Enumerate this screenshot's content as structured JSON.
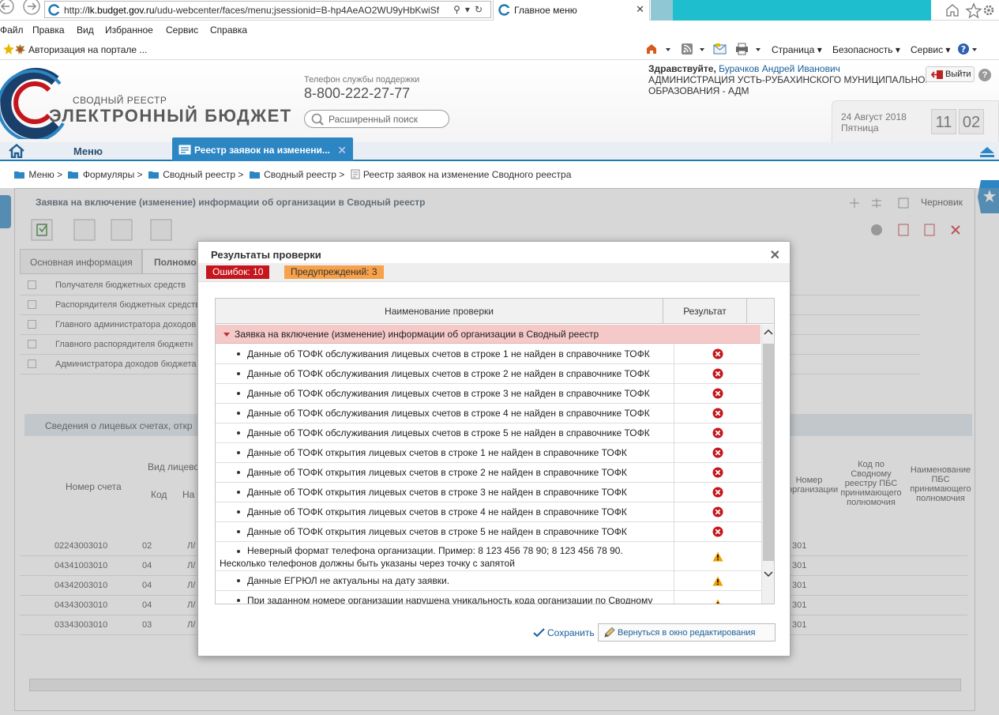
{
  "browser": {
    "url_prefix": "http://",
    "url_domain": "lk.budget.gov.ru",
    "url_rest": "/udu-webcenter/faces/menu;jsessionid=B-hp4AeAO2WU9yHbKwiSf",
    "tab_title": "Главное меню",
    "menu": [
      "Файл",
      "Правка",
      "Вид",
      "Избранное",
      "Сервис",
      "Справка"
    ],
    "favorite": "Авторизация на портале ...",
    "commands": [
      "Страница ▾",
      "Безопасность ▾",
      "Сервис ▾"
    ]
  },
  "header": {
    "logo_sub": "СВОДНЫЙ РЕЕСТР",
    "logo_main": "ЭЛЕКТРОННЫЙ БЮДЖЕТ",
    "support_label": "Телефон службы поддержки",
    "support_phone": "8-800-222-27-77",
    "search_placeholder": "Расширенный поиск",
    "greeting": "Здравствуйте,",
    "user_name": "Бурачков Андрей Иванович",
    "org_line1": "АДМИНИСТРАЦИЯ УСТЬ-РУБАХИНСКОГО МУНИЦИПАЛЬНОГО",
    "org_line2": "ОБРАЗОВАНИЯ - АДМ",
    "exit_label": "Выйти",
    "help_label": "?",
    "date": "24 Август 2018",
    "weekday": "Пятница",
    "hours": "11",
    "minutes": "02"
  },
  "nav": {
    "menu_label": "Меню",
    "tab_label": "Реестр заявок на изменени..."
  },
  "breadcrumbs": [
    "Меню >",
    "Формуляры >",
    "Сводный реестр >",
    "Сводный реестр >",
    "Реестр заявок на изменение Сводного реестра"
  ],
  "background": {
    "form_title": "Заявка на включение (изменение) информации об организации в Сводный реестр",
    "draft_label": "Черновик",
    "tab_main": "Основная информация",
    "tab_powers": "Полномо",
    "list_rows": [
      "Получателя бюджетных средств",
      "Распорядителя бюджетных средств",
      "Главного администратора доходов",
      "Главного распорядителя бюджетн",
      "Администратора доходов бюджета"
    ],
    "section_title": "Сведения о лицевых счетах, откр",
    "col_account": "Номер счета",
    "col_type": "Вид лицево",
    "col_code": "Код",
    "col_name": "На",
    "col_org_num": "Номер организации",
    "col_pbs_code": "Код по Сводному реестру ПБС принимающего полномочия",
    "col_pbs_name": "Наименование ПБС принимающего полномочия",
    "accounts": [
      {
        "num": "02243003010",
        "code": "02",
        "abbr": "Л/",
        "tail": "301"
      },
      {
        "num": "04341003010",
        "code": "04",
        "abbr": "Л/",
        "tail": "301"
      },
      {
        "num": "04342003010",
        "code": "04",
        "abbr": "Л/",
        "tail": "301"
      },
      {
        "num": "04343003010",
        "code": "04",
        "abbr": "Л/",
        "tail": "301"
      },
      {
        "num": "03343003010",
        "code": "03",
        "abbr": "Л/",
        "tail": "301"
      }
    ]
  },
  "dialog": {
    "title": "Результаты проверки",
    "errors_badge": "Ошибок: 10",
    "warnings_badge": "Предупреждений: 3",
    "col_check": "Наименование проверки",
    "col_result": "Результат",
    "group_title": "Заявка на включение (изменение) информации об организации в Сводный реестр",
    "rows": [
      {
        "text": "Данные об ТОФК обслуживания лицевых счетов в строке 1 не найден в справочнике ТОФК",
        "status": "error"
      },
      {
        "text": "Данные об ТОФК обслуживания лицевых счетов в строке 2 не найден в справочнике ТОФК",
        "status": "error"
      },
      {
        "text": "Данные об ТОФК обслуживания лицевых счетов в строке 3 не найден в справочнике ТОФК",
        "status": "error"
      },
      {
        "text": "Данные об ТОФК обслуживания лицевых счетов в строке 4 не найден в справочнике ТОФК",
        "status": "error"
      },
      {
        "text": "Данные об ТОФК обслуживания лицевых счетов в строке 5 не найден в справочнике ТОФК",
        "status": "error"
      },
      {
        "text": "Данные об ТОФК открытия лицевых счетов в строке 1 не найден в справочнике ТОФК",
        "status": "error"
      },
      {
        "text": "Данные об ТОФК открытия лицевых счетов в строке 2 не найден в справочнике ТОФК",
        "status": "error"
      },
      {
        "text": "Данные об ТОФК открытия лицевых счетов в строке 3 не найден в справочнике ТОФК",
        "status": "error"
      },
      {
        "text": "Данные об ТОФК открытия лицевых счетов в строке 4 не найден в справочнике ТОФК",
        "status": "error"
      },
      {
        "text": "Данные об ТОФК открытия лицевых счетов в строке 5 не найден в справочнике ТОФК",
        "status": "error"
      },
      {
        "text": "Неверный формат телефона организации. Пример: 8 123 456 78 90; 8 123 456 78 90.",
        "text2": "Несколько телефонов должны быть указаны через точку с запятой",
        "status": "warning"
      },
      {
        "text": "Данные ЕГРЮЛ не актуальны на дату заявки.",
        "status": "warning"
      },
      {
        "text": "При заданном номере организации нарушена уникальность кода организации по Сводному",
        "status": "warning"
      }
    ],
    "save_label": "Сохранить",
    "back_label": "Вернуться в окно редактирования"
  },
  "colors": {
    "accent": "#2c86c4",
    "error": "#c4161c",
    "warning": "#f7a14a",
    "group_bg": "#f6c9c9"
  }
}
